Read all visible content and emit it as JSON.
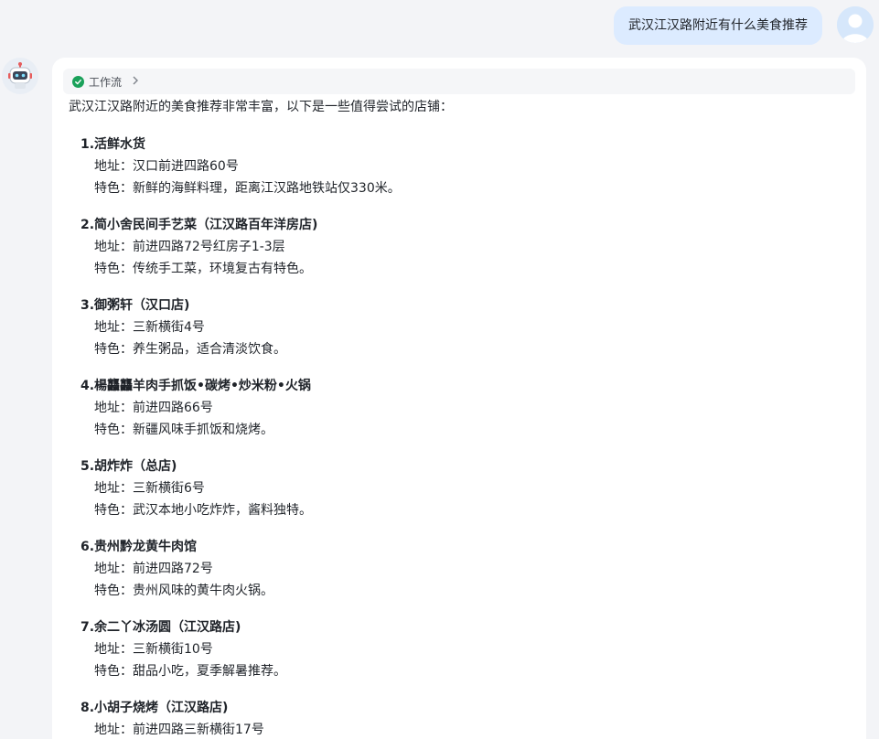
{
  "user_message": {
    "text": "武汉江汉路附近有什么美食推荐"
  },
  "bot": {
    "workflow_label": "工作流",
    "intro": "武汉江汉路附近的美食推荐非常丰富，以下是一些值得尝试的店铺：",
    "restaurants": [
      {
        "num": "1.",
        "name": "活鲜水货",
        "address": "地址：汉口前进四路60号",
        "feature": "特色：新鲜的海鲜料理，距离江汉路地铁站仅330米。"
      },
      {
        "num": "2.",
        "name": "简小舍民间手艺菜（江汉路百年洋房店)",
        "address": "地址：前进四路72号红房子1-3层",
        "feature": "特色：传统手工菜，环境复古有特色。"
      },
      {
        "num": "3.",
        "name": "御粥轩（汉口店)",
        "address": "地址：三新横街4号",
        "feature": "特色：养生粥品，适合清淡饮食。"
      },
      {
        "num": "4.",
        "name": "楊龘龘羊肉手抓饭•碳烤•炒米粉•火锅",
        "address": "地址：前进四路66号",
        "feature": "特色：新疆风味手抓饭和烧烤。"
      },
      {
        "num": "5.",
        "name": "胡炸炸（总店)",
        "address": "地址：三新横街6号",
        "feature": "特色：武汉本地小吃炸炸，酱料独特。"
      },
      {
        "num": "6.",
        "name": "贵州黔龙黄牛肉馆",
        "address": "地址：前进四路72号",
        "feature": "特色：贵州风味的黄牛肉火锅。"
      },
      {
        "num": "7.",
        "name": "余二丫冰汤圆（江汉路店)",
        "address": "地址：三新横街10号",
        "feature": "特色：甜品小吃，夏季解暑推荐。"
      },
      {
        "num": "8.",
        "name": "小胡子烧烤（江汉路店)",
        "address": "地址：前进四路三新横街17号",
        "feature": ""
      }
    ]
  },
  "colors": {
    "user_bubble": "#dcebff",
    "check": "#1aa15a",
    "page_bg": "#f3f4f7"
  },
  "icons": {
    "workflow_status": "check-circle-icon",
    "expand": "chevron-right-icon",
    "bot_avatar": "robot-icon",
    "user_avatar": "user-icon"
  }
}
